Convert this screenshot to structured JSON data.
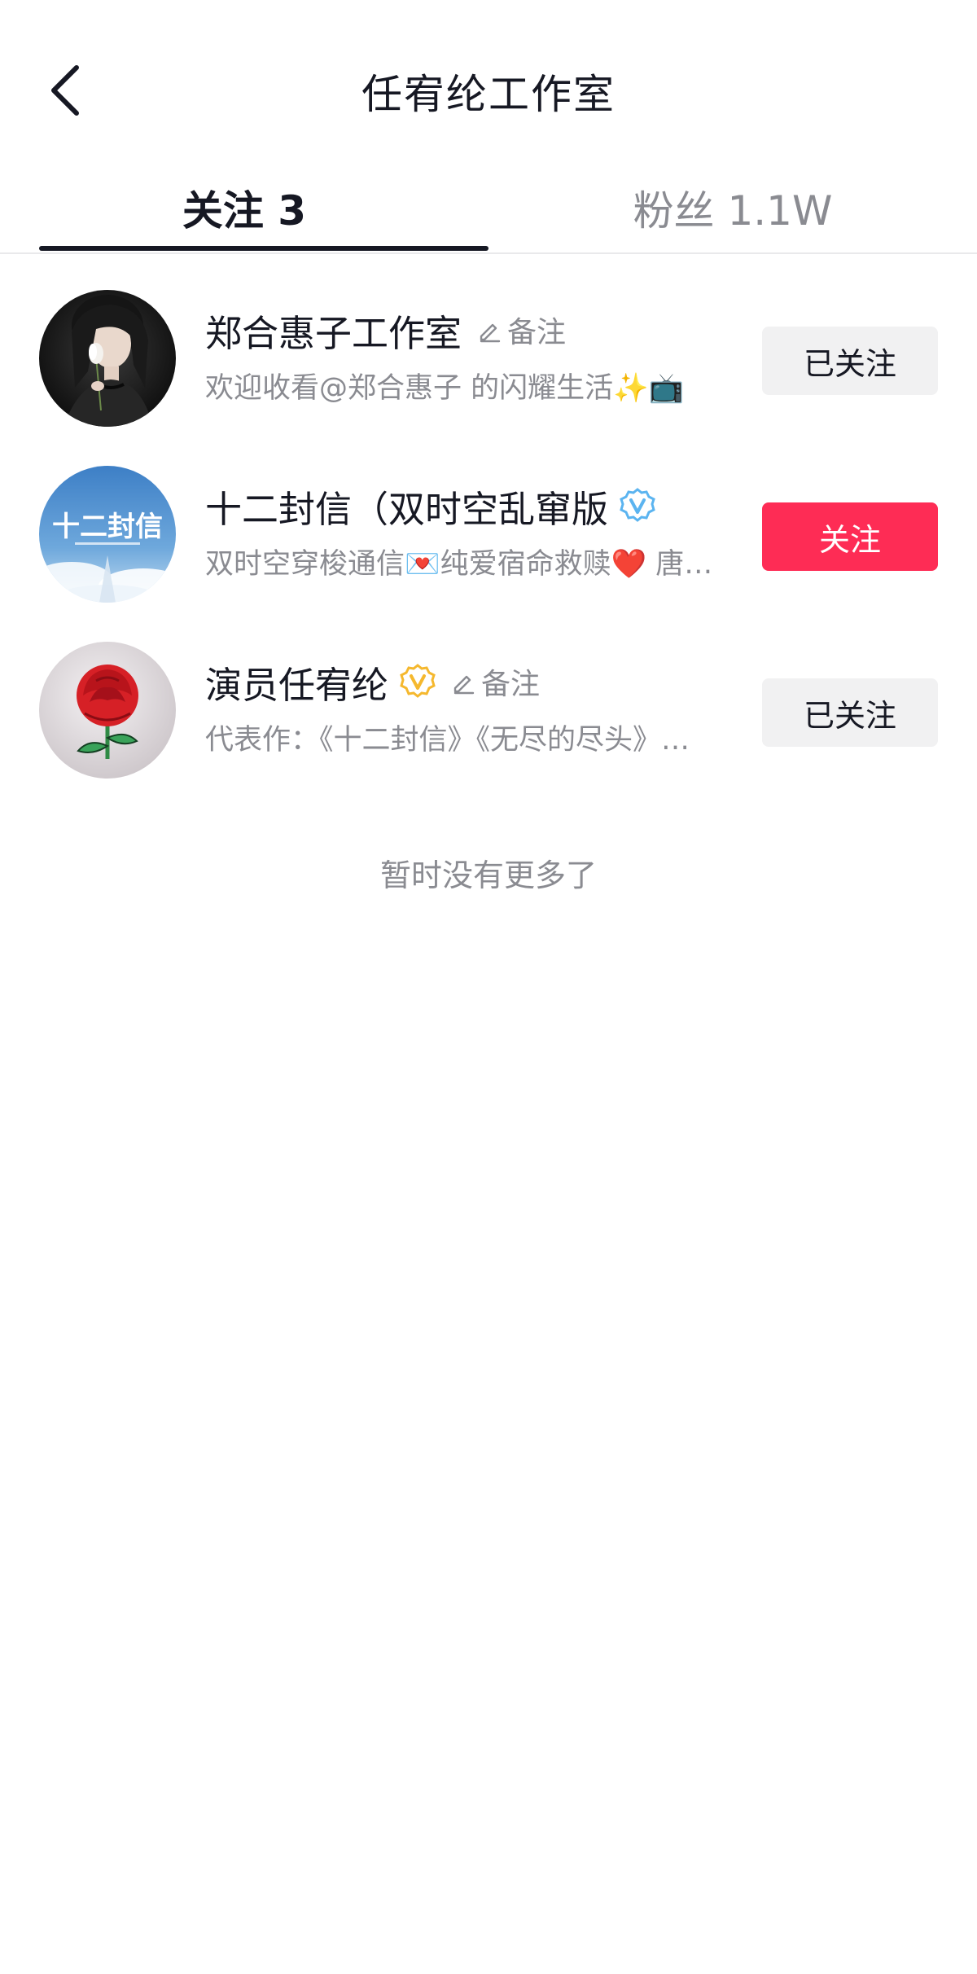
{
  "header": {
    "back_icon": "chevron-left-icon",
    "title": "任宥纶工作室"
  },
  "tabs": [
    {
      "label": "关注 3",
      "active": true
    },
    {
      "label": "粉丝 1.1W",
      "active": false
    }
  ],
  "users": [
    {
      "name": "郑合惠子工作室",
      "verified": false,
      "remark_label": "备注",
      "description": "欢迎收看@郑合惠子 的闪耀生活✨📺",
      "button_label": "已关注",
      "button_state": "followed"
    },
    {
      "name": "十二封信（双时空乱窜版",
      "verified": true,
      "badge_color": "#5bb4f0",
      "description": "双时空穿梭通信💌纯爱宿命救赎❤️ 唐…",
      "button_label": "关注",
      "button_state": "primary",
      "avatar_text": "十二封信"
    },
    {
      "name": "演员任宥纶",
      "verified": true,
      "badge_color": "#f5b82e",
      "remark_label": "备注",
      "description": "代表作：《十二封信》《无尽的尽头》…",
      "button_label": "已关注",
      "button_state": "followed"
    }
  ],
  "footer": {
    "no_more_text": "暂时没有更多了"
  },
  "colors": {
    "primary": "#fe2c55",
    "text": "#161823",
    "secondary_text": "#8a8b91",
    "followed_bg": "#f1f1f2"
  }
}
